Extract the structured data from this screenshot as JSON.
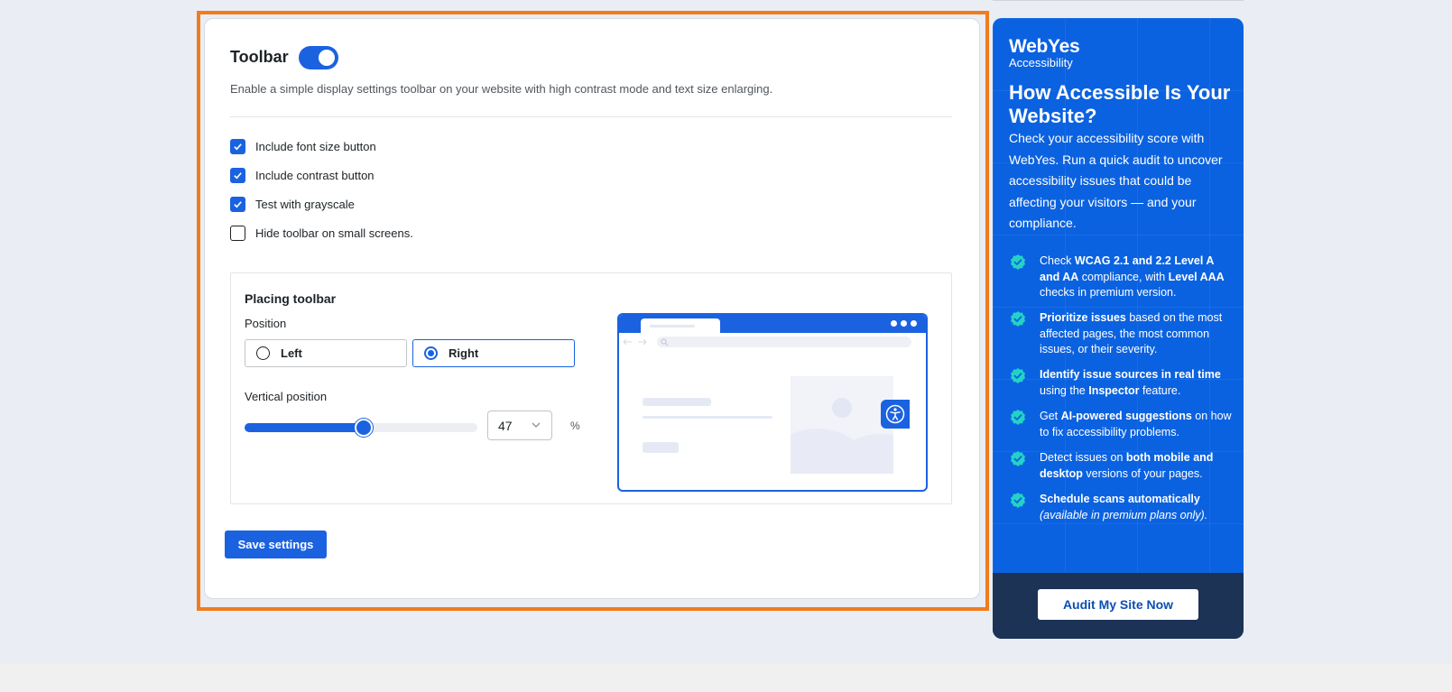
{
  "toolbar": {
    "title": "Toolbar",
    "enabled": true,
    "description": "Enable a simple display settings toolbar on your website with high contrast mode and text size enlarging."
  },
  "options": [
    {
      "label": "Include font size button",
      "checked": true
    },
    {
      "label": "Include contrast button",
      "checked": true
    },
    {
      "label": "Test with grayscale",
      "checked": true
    },
    {
      "label": "Hide toolbar on small screens.",
      "checked": false
    }
  ],
  "placing": {
    "title": "Placing toolbar",
    "position_label": "Position",
    "positions": [
      {
        "label": "Left",
        "selected": false
      },
      {
        "label": "Right",
        "selected": true
      }
    ],
    "vertical_label": "Vertical position",
    "vertical_value": "47",
    "vertical_percent": 47,
    "unit": "%"
  },
  "save_label": "Save settings",
  "promo": {
    "brand": "WebYes",
    "brand_sub": "Accessibility",
    "title": "How Accessible Is Your Website?",
    "text": "Check your accessibility score with WebYes. Run a quick audit to uncover accessibility issues that could be affecting your visitors — and your compliance.",
    "features": [
      {
        "html": "Check <b>WCAG 2.1 and 2.2 Level A and AA</b> compliance, with <b>Level AAA</b> checks in premium version."
      },
      {
        "html": "<b>Prioritize issues</b> based on the most affected pages, the most common issues, or their severity."
      },
      {
        "html": "<b>Identify issue sources in real time</b> using the <b>Inspector</b> feature."
      },
      {
        "html": "Get <b>AI-powered suggestions</b> on how to fix accessibility problems."
      },
      {
        "html": "Detect issues on <b>both mobile and desktop</b> versions of your pages."
      },
      {
        "html": "<b>Schedule scans automatically</b> <i>(available in premium plans only).</i>"
      }
    ],
    "cta": "Audit My Site Now"
  },
  "colors": {
    "accent": "#1b62e0",
    "promo_bg": "#0b62e0",
    "promo_footer": "#1c3356",
    "highlight": "#f07c1e",
    "check_badge": "#22d3c5"
  },
  "icons": {
    "checkbox": "check-icon",
    "feature_badge": "badge-check-icon",
    "select": "chevron-down-icon",
    "preview_button": "accessibility-icon",
    "search": "search-icon"
  }
}
